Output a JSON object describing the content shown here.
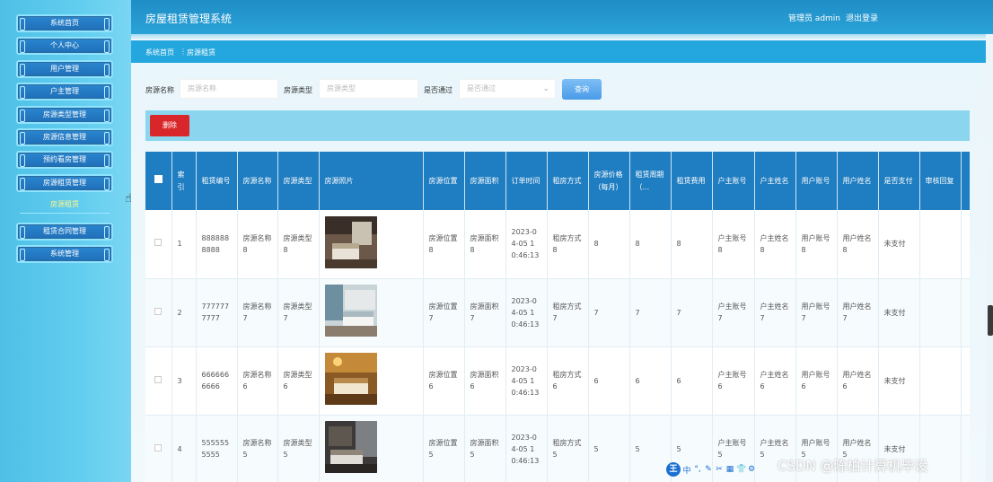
{
  "header": {
    "title": "房屋租赁管理系统",
    "admin_label": "管理员 admin",
    "logout_label": "退出登录"
  },
  "breadcrumb": {
    "home": "系统首页",
    "separator": "⋮",
    "current": "房源租赁"
  },
  "sidebar": {
    "items": [
      {
        "label": "系统首页"
      },
      {
        "label": "个人中心"
      },
      {
        "label": "用户管理"
      },
      {
        "label": "户主管理"
      },
      {
        "label": "房源类型管理"
      },
      {
        "label": "房源信息管理"
      },
      {
        "label": "预约看房管理"
      },
      {
        "label": "房源租赁管理"
      },
      {
        "label": "租赁合同管理"
      },
      {
        "label": "系统管理"
      }
    ],
    "active_sub": "房源租赁"
  },
  "filters": {
    "name_label": "房源名称",
    "name_placeholder": "房源名称",
    "type_label": "房源类型",
    "type_placeholder": "房源类型",
    "pass_label": "是否通过",
    "pass_placeholder": "是否通过",
    "query_label": "查询"
  },
  "actions": {
    "delete_label": "删除"
  },
  "table": {
    "headers": [
      "索引",
      "租赁编号",
      "房源名称",
      "房源类型",
      "房源照片",
      "房源位置",
      "房源面积",
      "订单时间",
      "租房方式",
      "房源价格（每月）",
      "租赁周期（...",
      "租赁费用",
      "户主账号",
      "户主姓名",
      "用户账号",
      "用户姓名",
      "是否支付",
      "审核回复"
    ],
    "rows": [
      {
        "idx": "1",
        "code": "8888888888",
        "name": "房源名称8",
        "type": "房源类型8",
        "loc": "房源位置8",
        "area": "房源面积8",
        "time": "2023-04-05 10:46:13",
        "mode": "租房方式8",
        "price": "8",
        "period": "8",
        "fee": "8",
        "owner_acc": "户主账号8",
        "owner_name": "户主姓名8",
        "user_acc": "用户账号8",
        "user_name": "用户姓名8",
        "paid": "未支付"
      },
      {
        "idx": "2",
        "code": "7777777777",
        "name": "房源名称7",
        "type": "房源类型7",
        "loc": "房源位置7",
        "area": "房源面积7",
        "time": "2023-04-05 10:46:13",
        "mode": "租房方式7",
        "price": "7",
        "period": "7",
        "fee": "7",
        "owner_acc": "户主账号7",
        "owner_name": "户主姓名7",
        "user_acc": "用户账号7",
        "user_name": "用户姓名7",
        "paid": "未支付"
      },
      {
        "idx": "3",
        "code": "6666666666",
        "name": "房源名称6",
        "type": "房源类型6",
        "loc": "房源位置6",
        "area": "房源面积6",
        "time": "2023-04-05 10:46:13",
        "mode": "租房方式6",
        "price": "6",
        "period": "6",
        "fee": "6",
        "owner_acc": "户主账号6",
        "owner_name": "户主姓名6",
        "user_acc": "用户账号6",
        "user_name": "用户姓名6",
        "paid": "未支付"
      },
      {
        "idx": "4",
        "code": "5555555555",
        "name": "房源名称5",
        "type": "房源类型5",
        "loc": "房源位置5",
        "area": "房源面积5",
        "time": "2023-04-05 10:46:13",
        "mode": "租房方式5",
        "price": "5",
        "period": "5",
        "fee": "5",
        "owner_acc": "户主账号5",
        "owner_name": "户主姓名5",
        "user_acc": "用户账号5",
        "user_name": "用户姓名5",
        "paid": "未支付"
      }
    ]
  },
  "watermark": "CSDN @陈柏计算机毕设",
  "ime_toolbar": {
    "logo": "王",
    "items": [
      "中",
      "°,",
      "✎",
      "✂",
      "▦",
      "👕",
      "⚙"
    ]
  },
  "colors": {
    "header": "#1f8dc6",
    "breadcrumb": "#24a7de",
    "table_header": "#1f7dc1",
    "delete": "#d9262a",
    "query": "#4a9be8"
  }
}
